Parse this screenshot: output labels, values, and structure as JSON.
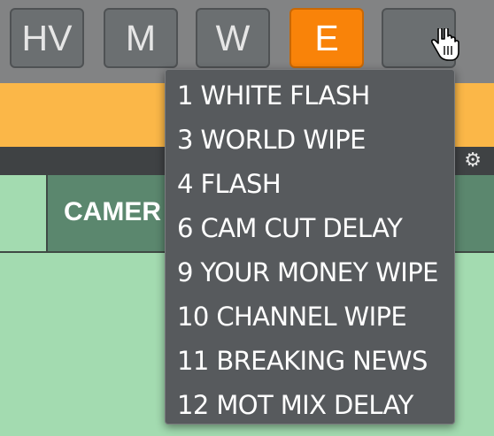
{
  "toolbar": {
    "buttons": [
      {
        "label": "HV",
        "active": false
      },
      {
        "label": "M",
        "active": false
      },
      {
        "label": "W",
        "active": false
      },
      {
        "label": "E",
        "active": true
      },
      {
        "label": "",
        "active": false
      }
    ]
  },
  "grid": {
    "camera_cell_label": "CAMER"
  },
  "dropdown": {
    "items": [
      "1 WHITE FLASH",
      "3 WORLD WIPE",
      "4 FLASH",
      "6 CAM CUT DELAY",
      "9 YOUR MONEY WIPE",
      "10 CHANNEL WIPE",
      "11 BREAKING NEWS",
      "12 MOT MIX DELAY"
    ]
  },
  "colors": {
    "active_button": "#f98309",
    "orange_strip": "#fbb748",
    "camera_cell": "#5b876e",
    "background_green": "#a3dbb0"
  },
  "icons": [
    "gear-icon",
    "hand-cursor-icon"
  ]
}
